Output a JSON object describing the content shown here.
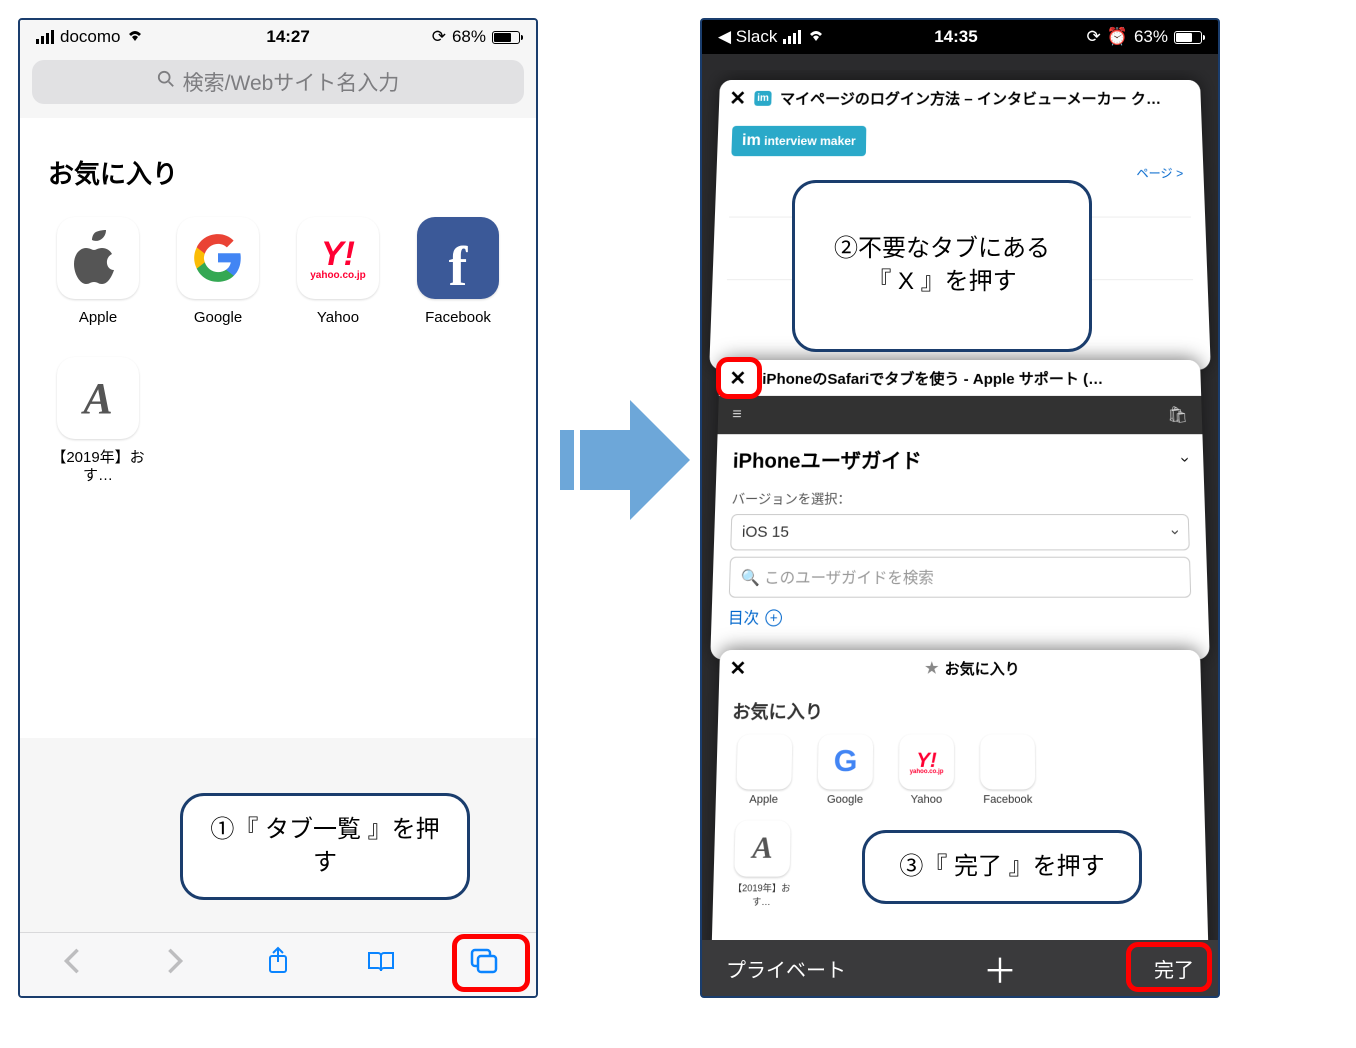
{
  "left": {
    "status": {
      "carrier": "docomo",
      "time": "14:27",
      "battery": "68%"
    },
    "search_placeholder": "検索/Webサイト名入力",
    "favorites_title": "お気に入り",
    "favorites": [
      {
        "label": "Apple"
      },
      {
        "label": "Google"
      },
      {
        "label": "Yahoo",
        "sub": "yahoo.co.jp"
      },
      {
        "label": "Facebook"
      },
      {
        "label": "【2019年】おす…"
      }
    ],
    "callout1": "①『 タブ一覧 』を押す"
  },
  "right": {
    "status": {
      "back_app": "◀ Slack",
      "time": "14:35",
      "battery": "63%"
    },
    "tabs": [
      {
        "title": "マイページのログイン方法 – インタビューメーカー ク…",
        "badge": "interview maker",
        "breadcrumb": "ページ  >"
      },
      {
        "title": "iPhoneのSafariでタブを使う - Apple サポート (…",
        "guide_title": "iPhoneユーザガイド",
        "version_label": "バージョンを選択：",
        "version_value": "iOS 15",
        "search_placeholder": "このユーザガイドを検索",
        "toc": "目次"
      },
      {
        "title": "お気に入り",
        "fav_title": "お気に入り",
        "items": [
          {
            "label": "Apple"
          },
          {
            "label": "Google"
          },
          {
            "label": "Yahoo",
            "sub": "yahoo.co.jp"
          },
          {
            "label": "Facebook"
          },
          {
            "label": "【2019年】おす…"
          }
        ]
      }
    ],
    "bottombar": {
      "private": "プライベート",
      "done": "完了"
    },
    "callout2": "②不要なタブにある\n『 X 』を押す",
    "callout3": "③『 完了 』を押す"
  }
}
